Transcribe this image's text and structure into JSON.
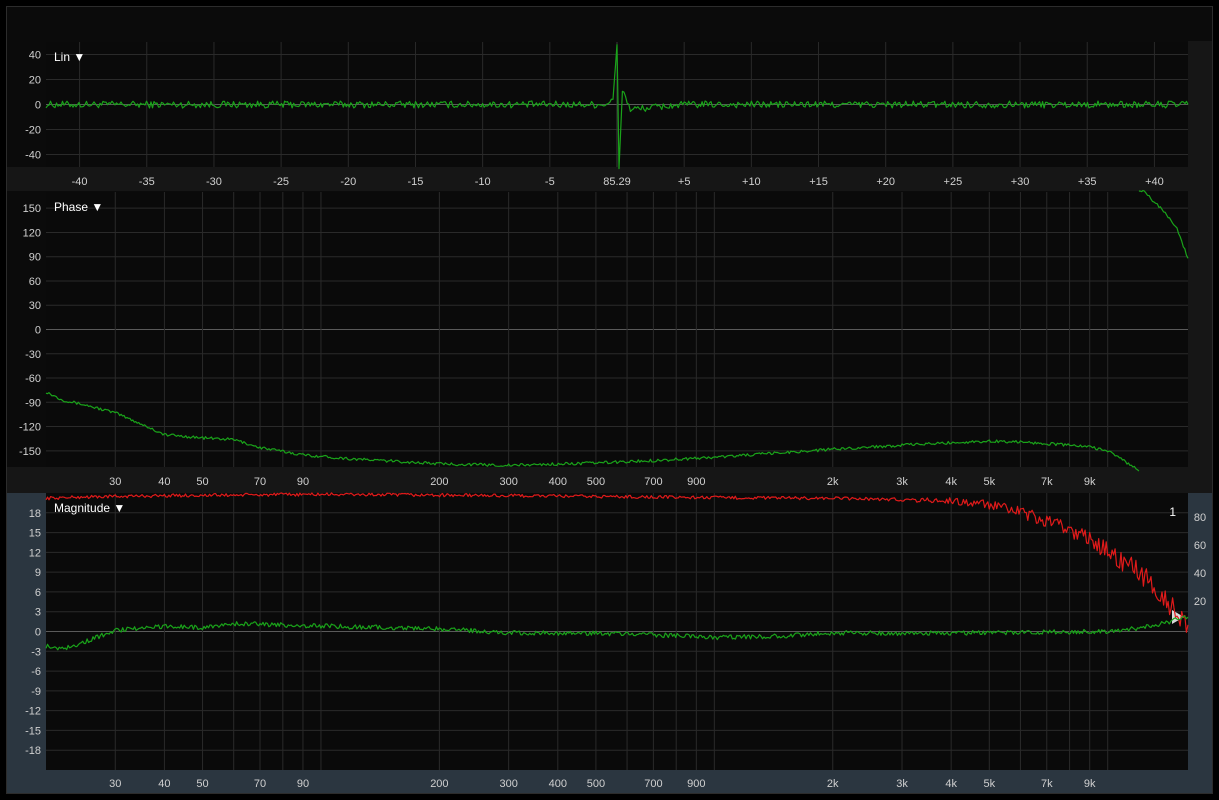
{
  "chart_data": [
    {
      "panel": "impulse",
      "type": "line",
      "title": "",
      "menu_label": "Lin ▼",
      "x_tick_labels": [
        "-40",
        "-35",
        "-30",
        "-25",
        "-20",
        "-15",
        "-10",
        "-5",
        "85.29",
        "+5",
        "+10",
        "+15",
        "+20",
        "+25",
        "+30",
        "+35",
        "+40"
      ],
      "xlim": [
        -42.5,
        42.5
      ],
      "ylim": [
        -50,
        50
      ],
      "y_ticks": [
        40,
        20,
        0,
        -20,
        -40
      ],
      "grid": true,
      "series": [
        {
          "color": "#1aa31a",
          "x": [
            -42.5,
            -30,
            -15,
            -5,
            -1,
            -0.3,
            0,
            0.15,
            0.4,
            1,
            5,
            15,
            30,
            42.5
          ],
          "y": [
            0,
            0,
            0,
            0,
            0,
            3,
            48,
            -50,
            12,
            -4,
            0,
            0,
            0,
            0
          ]
        }
      ]
    },
    {
      "panel": "phase",
      "type": "line",
      "title": "",
      "menu_label": "Phase ▼",
      "xscale": "log",
      "xlim": [
        20,
        16000
      ],
      "ylim": [
        -170,
        170
      ],
      "y_ticks": [
        150,
        120,
        90,
        60,
        30,
        0,
        -30,
        -60,
        -90,
        -120,
        -150
      ],
      "x_ticks": [
        30,
        40,
        50,
        70,
        90,
        200,
        300,
        400,
        500,
        700,
        900,
        2000,
        3000,
        4000,
        5000,
        7000,
        9000
      ],
      "x_tick_labels": [
        "30",
        "40",
        "50",
        "70",
        "90",
        "200",
        "300",
        "400",
        "500",
        "700",
        "900",
        "2k",
        "3k",
        "4k",
        "5k",
        "7k",
        "9k"
      ],
      "grid": true,
      "series": [
        {
          "color": "#1aa31a",
          "x": [
            20,
            22,
            25,
            30,
            35,
            40,
            50,
            60,
            70,
            90,
            120,
            200,
            300,
            500,
            700,
            1000,
            2000,
            3000,
            4000,
            5000,
            6000,
            7000,
            8000,
            9000,
            10000,
            11000,
            12000
          ],
          "y": [
            -77,
            -87,
            -93,
            -103,
            -117,
            -130,
            -134,
            -136,
            -146,
            -155,
            -160,
            -166,
            -168,
            -165,
            -162,
            -158,
            -148,
            -143,
            -140,
            -138,
            -139,
            -141,
            -143,
            -145,
            -150,
            -162,
            -175
          ]
        },
        {
          "color": "#1aa31a",
          "x": [
            12000,
            12500,
            13000,
            14000,
            15000,
            16000
          ],
          "y": [
            173,
            170,
            160,
            145,
            125,
            88
          ]
        }
      ]
    },
    {
      "panel": "magnitude",
      "type": "line",
      "title": "",
      "menu_label": "Magnitude ▼",
      "xscale": "log",
      "xlim": [
        20,
        16000
      ],
      "ylim": [
        -21,
        21
      ],
      "y_ticks": [
        18,
        15,
        12,
        9,
        6,
        3,
        0,
        -3,
        -6,
        -9,
        -12,
        -15,
        -18
      ],
      "right_axis": {
        "ticks": [
          80,
          60,
          40,
          20
        ],
        "top_label": "1"
      },
      "x_ticks": [
        30,
        40,
        50,
        70,
        90,
        200,
        300,
        400,
        500,
        700,
        900,
        2000,
        3000,
        4000,
        5000,
        7000,
        9000
      ],
      "x_tick_labels": [
        "30",
        "40",
        "50",
        "70",
        "90",
        "200",
        "300",
        "400",
        "500",
        "700",
        "900",
        "2k",
        "3k",
        "4k",
        "5k",
        "7k",
        "9k"
      ],
      "grid": true,
      "series": [
        {
          "color": "#e01a1a",
          "x": [
            20,
            25,
            40,
            100,
            300,
            1000,
            2000,
            3000,
            4000,
            5000,
            6000,
            7000,
            8000,
            9000,
            10000,
            11000,
            12000,
            13000,
            14000,
            15000,
            16000
          ],
          "y": [
            20.2,
            20.4,
            20.6,
            20.8,
            20.6,
            20.3,
            20.2,
            20.0,
            19.8,
            19.2,
            18.0,
            16.6,
            15.5,
            14.0,
            12.2,
            10.5,
            9.0,
            7.0,
            5.0,
            3.0,
            1.0
          ]
        },
        {
          "color": "#1aa31a",
          "x": [
            20,
            22,
            25,
            30,
            40,
            50,
            60,
            70,
            90,
            200,
            300,
            500,
            700,
            1000,
            1500,
            2000,
            3000,
            5000,
            7000,
            10000,
            13000,
            15000,
            16000
          ],
          "y": [
            -2.2,
            -2.6,
            -1.6,
            0.2,
            0.8,
            0.6,
            1.2,
            1.1,
            0.9,
            0.4,
            -0.2,
            -0.3,
            -0.5,
            -0.9,
            -0.7,
            -0.2,
            -0.3,
            -0.2,
            -0.1,
            0.0,
            0.8,
            1.8,
            2.2
          ]
        }
      ]
    }
  ]
}
